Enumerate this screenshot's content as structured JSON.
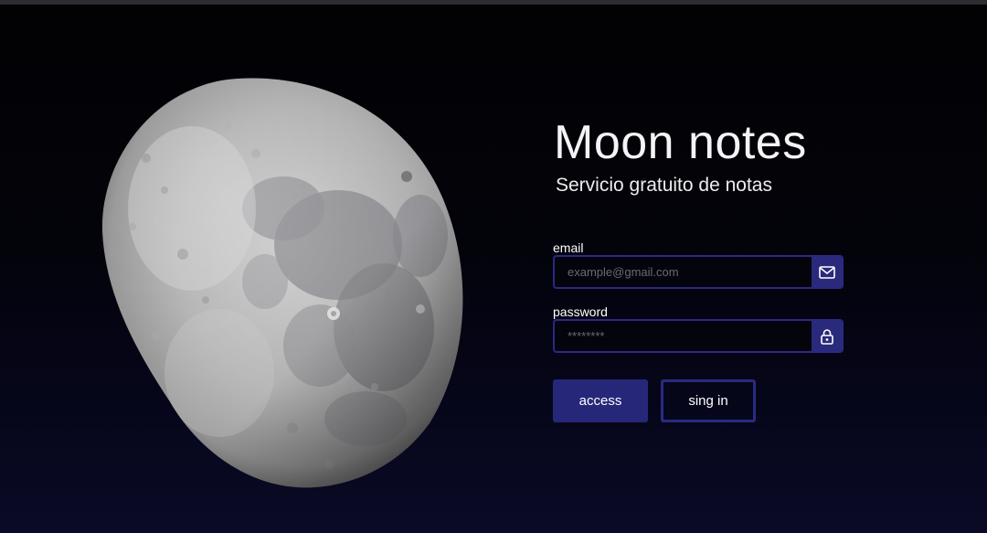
{
  "brand": {
    "title": "Moon notes",
    "subtitle": "Servicio gratuito de notas"
  },
  "form": {
    "email": {
      "label": "email",
      "placeholder": "example@gmail.com",
      "value": "",
      "icon": "mail-icon"
    },
    "password": {
      "label": "password",
      "placeholder": "********",
      "value": "",
      "icon": "lock-icon"
    },
    "buttons": {
      "access_label": "access",
      "signin_label": "sing in"
    }
  },
  "colors": {
    "accent": "#2a2a85",
    "button_fill": "#27277a",
    "background": "#000000",
    "text": "#ffffff"
  }
}
